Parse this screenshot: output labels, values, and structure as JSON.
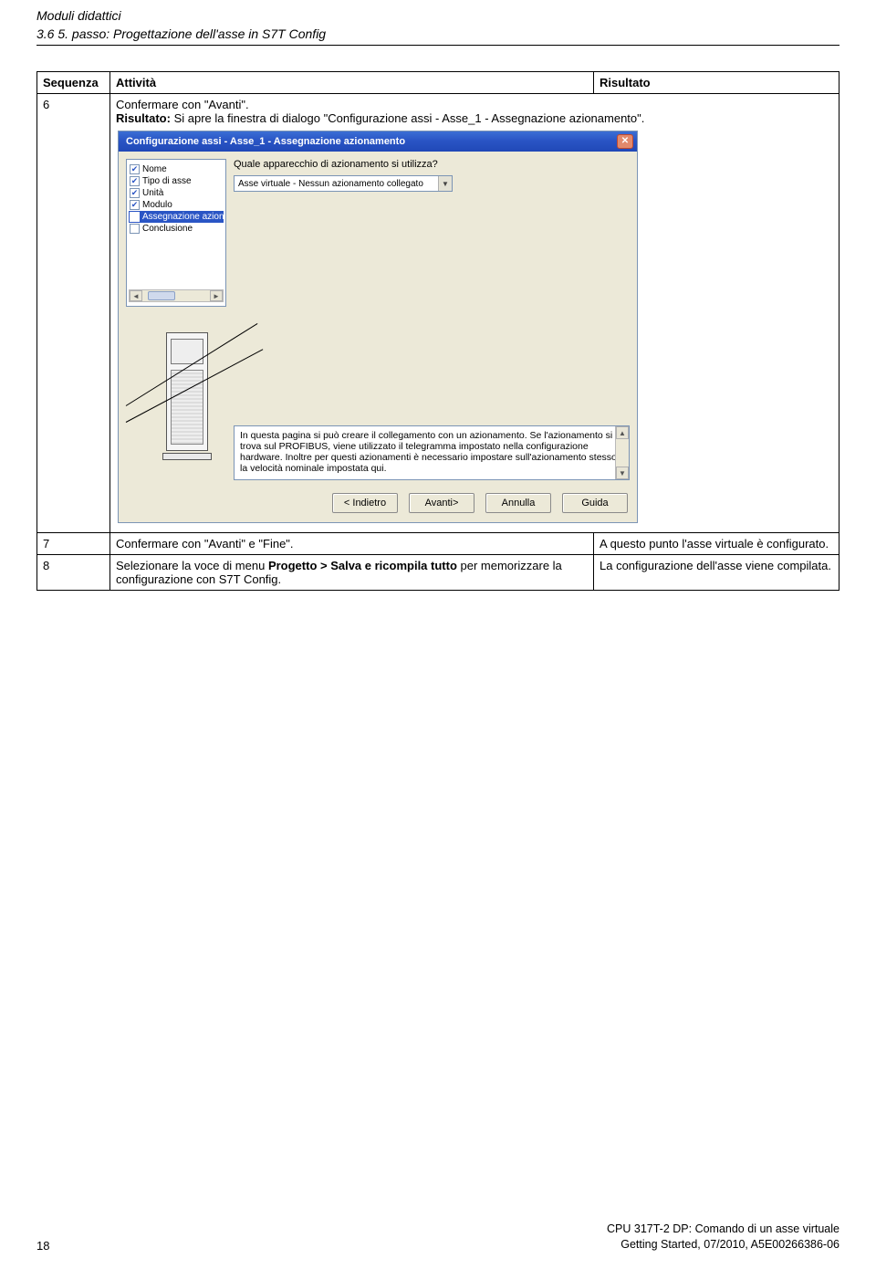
{
  "header": {
    "module_title": "Moduli didattici",
    "section_title": "3.6 5. passo: Progettazione dell'asse in S7T Config"
  },
  "table": {
    "headers": {
      "sequenza": "Sequenza",
      "attivita": "Attività",
      "risultato": "Risultato"
    },
    "row6": {
      "seq": "6",
      "activity_line1": "Confermare con \"Avanti\".",
      "activity_line2_prefix": "Risultato:",
      "activity_line2_rest": " Si apre la finestra di dialogo \"Configurazione assi - Asse_1 - Assegnazione azionamento\".",
      "result": ""
    },
    "row7": {
      "seq": "7",
      "activity": "Confermare con \"Avanti\" e \"Fine\".",
      "result": "A questo punto l'asse virtuale è configurato."
    },
    "row8": {
      "seq": "8",
      "activity_pre": "Selezionare la voce di menu ",
      "activity_bold": "Progetto > Salva e ricompila tutto",
      "activity_post": " per memorizzare la configurazione con S7T Config.",
      "result": "La configurazione dell'asse viene compilata."
    }
  },
  "dialog": {
    "title": "Configurazione assi - Asse_1 - Assegnazione azionamento",
    "left_items": [
      {
        "label": "Nome",
        "checked": true,
        "selected": false
      },
      {
        "label": "Tipo di asse",
        "checked": true,
        "selected": false
      },
      {
        "label": "Unità",
        "checked": true,
        "selected": false
      },
      {
        "label": "Modulo",
        "checked": true,
        "selected": false
      },
      {
        "label": "Assegnazione azionam",
        "checked": false,
        "selected": true
      },
      {
        "label": "Conclusione",
        "checked": false,
        "selected": false
      }
    ],
    "question": "Quale apparecchio di azionamento si utilizza?",
    "combo_value": "Asse virtuale - Nessun azionamento collegato",
    "info_text": "In questa pagina si può creare il collegamento con un azionamento. Se l'azionamento si trova sul PROFIBUS, viene utilizzato il telegramma impostato nella configurazione hardware. Inoltre per questi azionamenti è necessario impostare sull'azionamento stesso la velocità nominale impostata qui.",
    "buttons": {
      "back": "< Indietro",
      "next": "Avanti>",
      "cancel": "Annulla",
      "help": "Guida"
    }
  },
  "footer": {
    "page": "18",
    "line1": "CPU 317T-2 DP: Comando di un asse virtuale",
    "line2": "Getting Started, 07/2010, A5E00266386-06"
  }
}
